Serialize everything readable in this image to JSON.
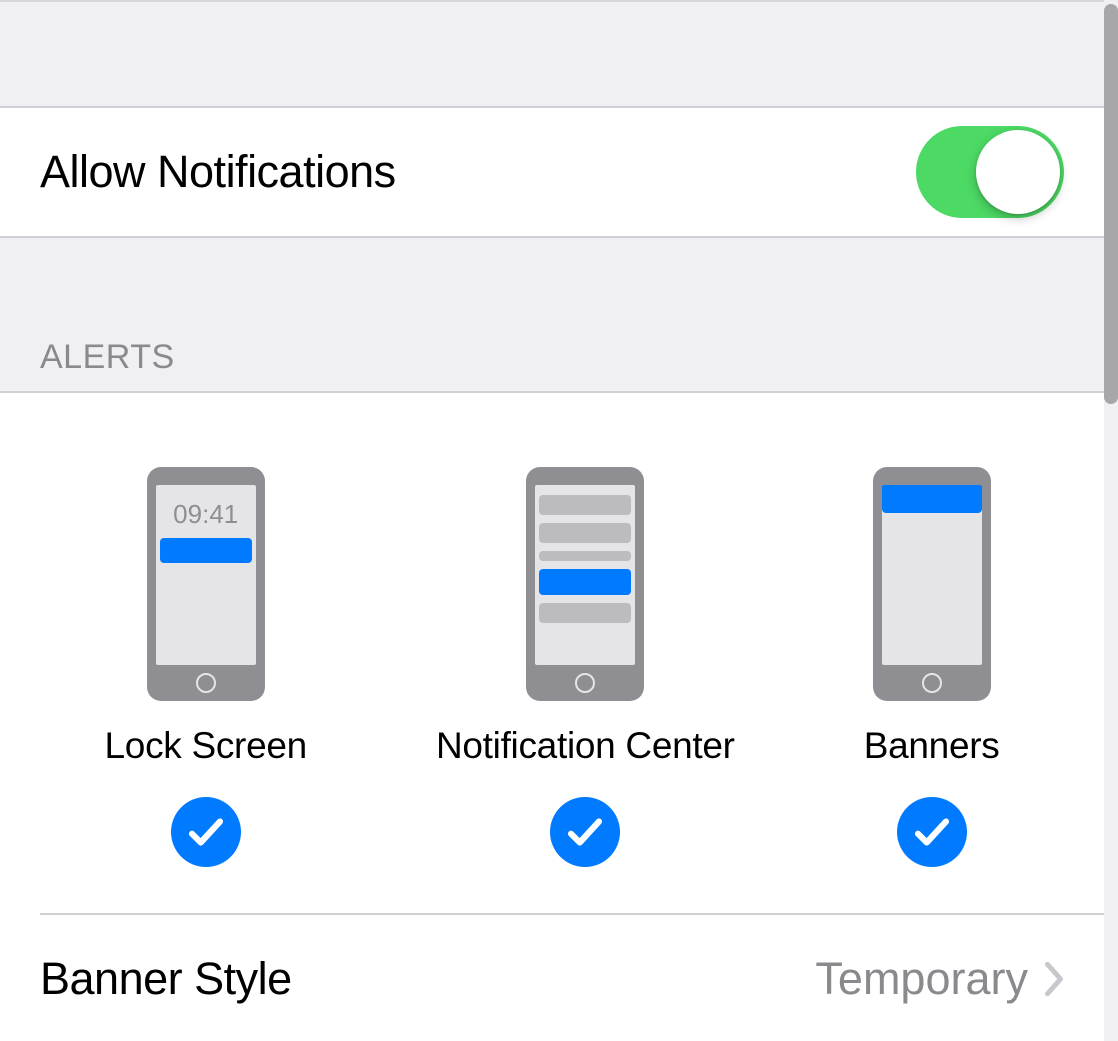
{
  "allow": {
    "label": "Allow Notifications",
    "enabled": true
  },
  "alerts": {
    "header": "ALERTS",
    "lock_time": "09:41",
    "options": [
      {
        "label": "Lock Screen",
        "checked": true
      },
      {
        "label": "Notification Center",
        "checked": true
      },
      {
        "label": "Banners",
        "checked": true
      }
    ]
  },
  "banner_style": {
    "label": "Banner Style",
    "value": "Temporary"
  },
  "colors": {
    "accent": "#007aff",
    "toggle_on": "#4cd964",
    "secondary_text": "#8a8a8e"
  }
}
